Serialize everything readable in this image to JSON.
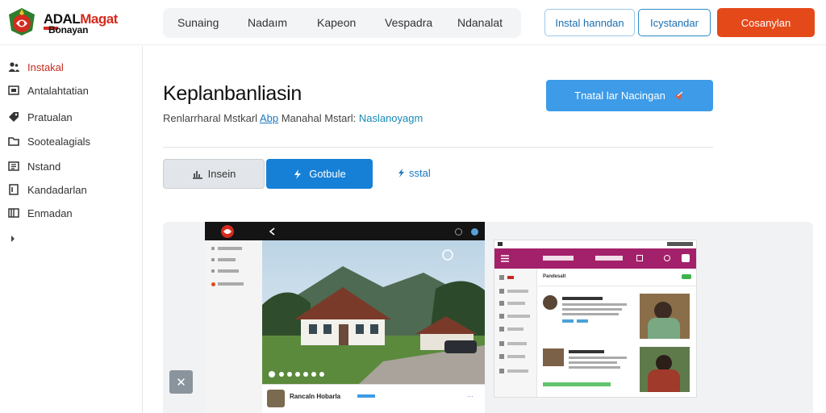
{
  "header": {
    "logo_line1_black": "ADAL",
    "logo_line1_red": "Magat",
    "logo_line2": "Bonayan",
    "nav": [
      "Sunaing",
      "Nadaım",
      "Kapeon",
      "Vespadra",
      "Ndanalat"
    ],
    "btn_install": "Instal hanndan",
    "btn_secondary": "Icystandar",
    "btn_primary": "Cosanylan"
  },
  "sidebar": {
    "items": [
      {
        "label": "Instakal",
        "icon": "users-icon"
      },
      {
        "label": "Antalahtatian",
        "icon": "image-icon"
      },
      {
        "label": "Pratualan",
        "icon": "tag-icon"
      },
      {
        "label": "Sootealagials",
        "icon": "folder-icon"
      },
      {
        "label": "Nstand",
        "icon": "list-icon"
      },
      {
        "label": "Kandadarlan",
        "icon": "document-icon"
      },
      {
        "label": "Enmadan",
        "icon": "book-icon"
      }
    ]
  },
  "main": {
    "title": "Keplanbanliasin",
    "subtitle_pre": "Renlarrharal Mstkarl",
    "subtitle_link": "Abp",
    "subtitle_mid": "Manahal Mstarl:",
    "subtitle_teal": "Naslanoyagm",
    "cta_label": "Tnatal lar Nacingan",
    "tab_grey": "Insein",
    "tab_blue": "Gotbule",
    "tab_link": "sstal"
  },
  "preview": {
    "tablet_caption": "Rancaln Hobarla",
    "phone_section": "Pandesalt"
  },
  "colors": {
    "accent_red": "#e4491a",
    "accent_blue": "#1680d6",
    "phone_bar": "#a3216a"
  }
}
